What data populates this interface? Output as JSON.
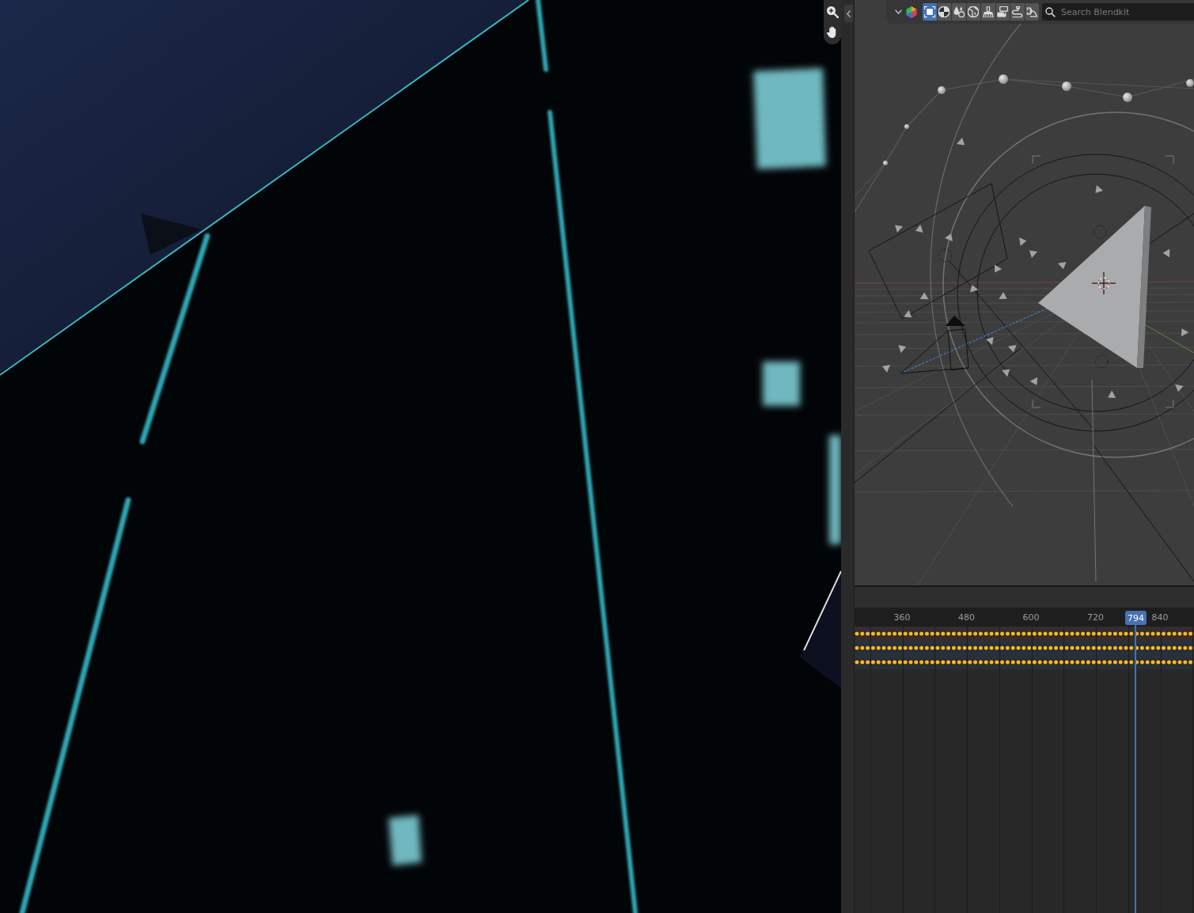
{
  "viewport_header": {
    "tools": [
      {
        "kind": "frame",
        "selected": true
      },
      {
        "kind": "pie",
        "selected": false
      },
      {
        "kind": "drops",
        "selected": false
      },
      {
        "kind": "globe",
        "selected": false
      },
      {
        "kind": "brush",
        "selected": false
      },
      {
        "kind": "cards",
        "selected": false
      },
      {
        "kind": "cable",
        "selected": false
      },
      {
        "kind": "plug",
        "selected": false
      }
    ],
    "search": {
      "placeholder": "Search Blendkit"
    }
  },
  "timeline": {
    "ruler_labels": [
      "360",
      "480",
      "600",
      "720",
      "840"
    ],
    "current_frame": "794",
    "channel_rows": [
      {
        "kind": "summary"
      },
      {
        "kind": "object"
      },
      {
        "kind": "object"
      }
    ]
  }
}
